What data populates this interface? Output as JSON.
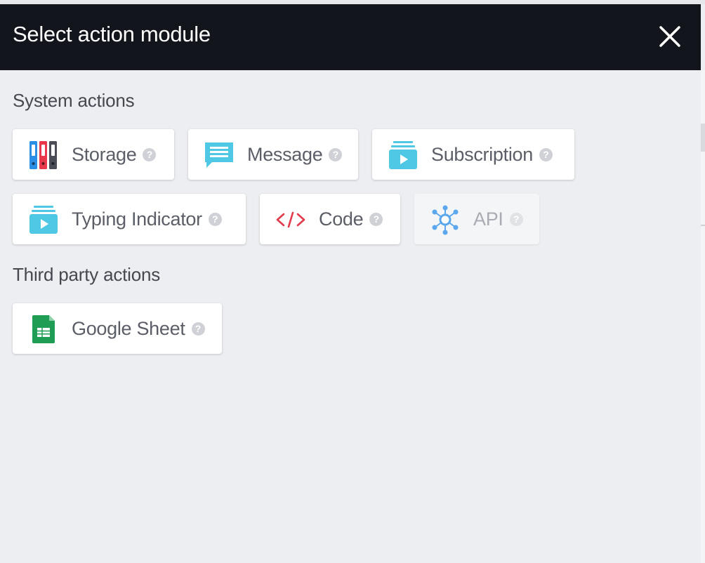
{
  "header": {
    "title": "Select action module",
    "close_icon": "close-icon"
  },
  "sections": {
    "system": {
      "title": "System actions",
      "items": [
        {
          "label": "Storage",
          "icon": "storage-binders-icon",
          "help": "?"
        },
        {
          "label": "Message",
          "icon": "message-bubble-icon",
          "help": "?"
        },
        {
          "label": "Subscription",
          "icon": "subscription-play-icon",
          "help": "?"
        },
        {
          "label": "Typing Indicator",
          "icon": "typing-indicator-icon",
          "help": "?"
        },
        {
          "label": "Code",
          "icon": "code-brackets-icon",
          "help": "?"
        },
        {
          "label": "API",
          "icon": "api-network-icon",
          "help": "?",
          "disabled": true
        }
      ]
    },
    "third_party": {
      "title": "Third party actions",
      "items": [
        {
          "label": "Google Sheet",
          "icon": "google-sheet-icon",
          "help": "?"
        }
      ]
    }
  },
  "colors": {
    "header_bg": "#13151d",
    "page_bg": "#eceef2",
    "accent_cyan": "#4fc8e6",
    "code_red": "#e23b4e",
    "sheet_green": "#1f9d55"
  }
}
